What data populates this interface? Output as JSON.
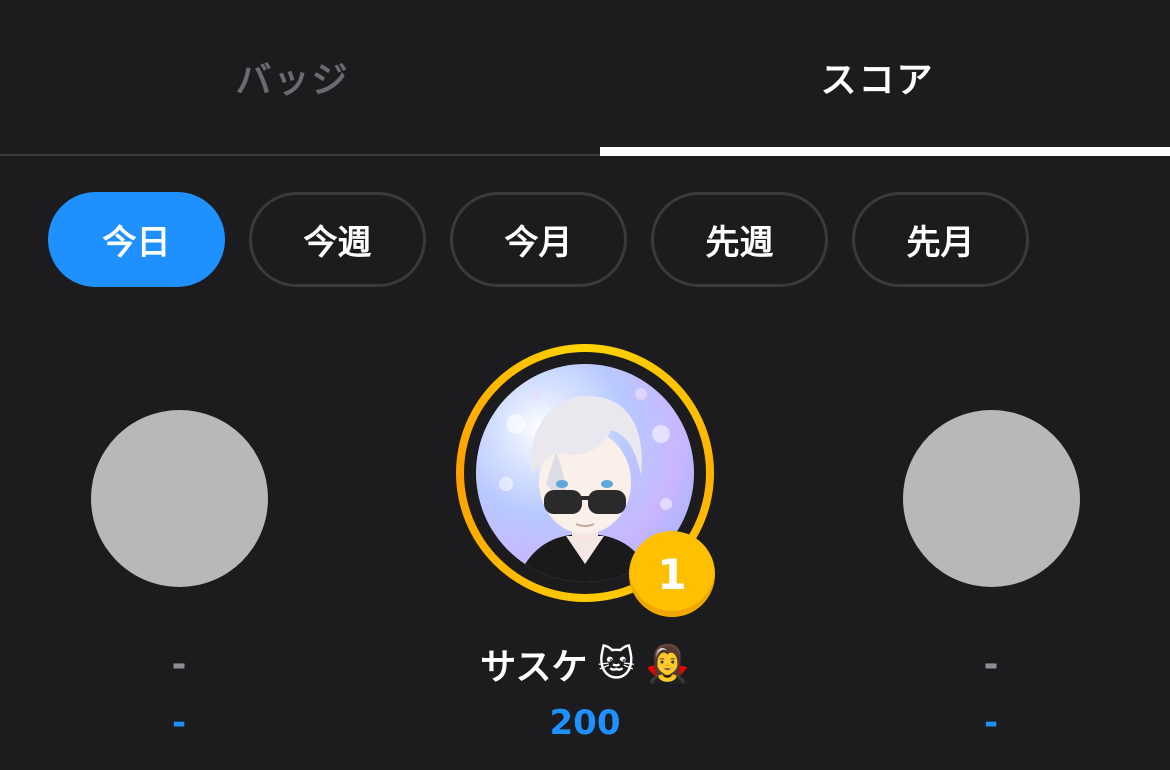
{
  "tabs": {
    "badge_label": "バッジ",
    "score_label": "スコア",
    "active": "スコア"
  },
  "periods": {
    "items": [
      "今日",
      "今週",
      "今月",
      "先週",
      "先月"
    ],
    "active": "今日"
  },
  "podium": {
    "left": {
      "name": "-",
      "score": "-"
    },
    "center": {
      "rank": "1",
      "name": "サスケ",
      "emojis": [
        "🐱",
        "🧛‍♀️"
      ],
      "score": "200"
    },
    "right": {
      "name": "-",
      "score": "-"
    }
  },
  "colors": {
    "background": "#1c1c1e",
    "accent": "#1e90ff",
    "gold": "#ffc000",
    "placeholder": "#b8b8b8"
  }
}
